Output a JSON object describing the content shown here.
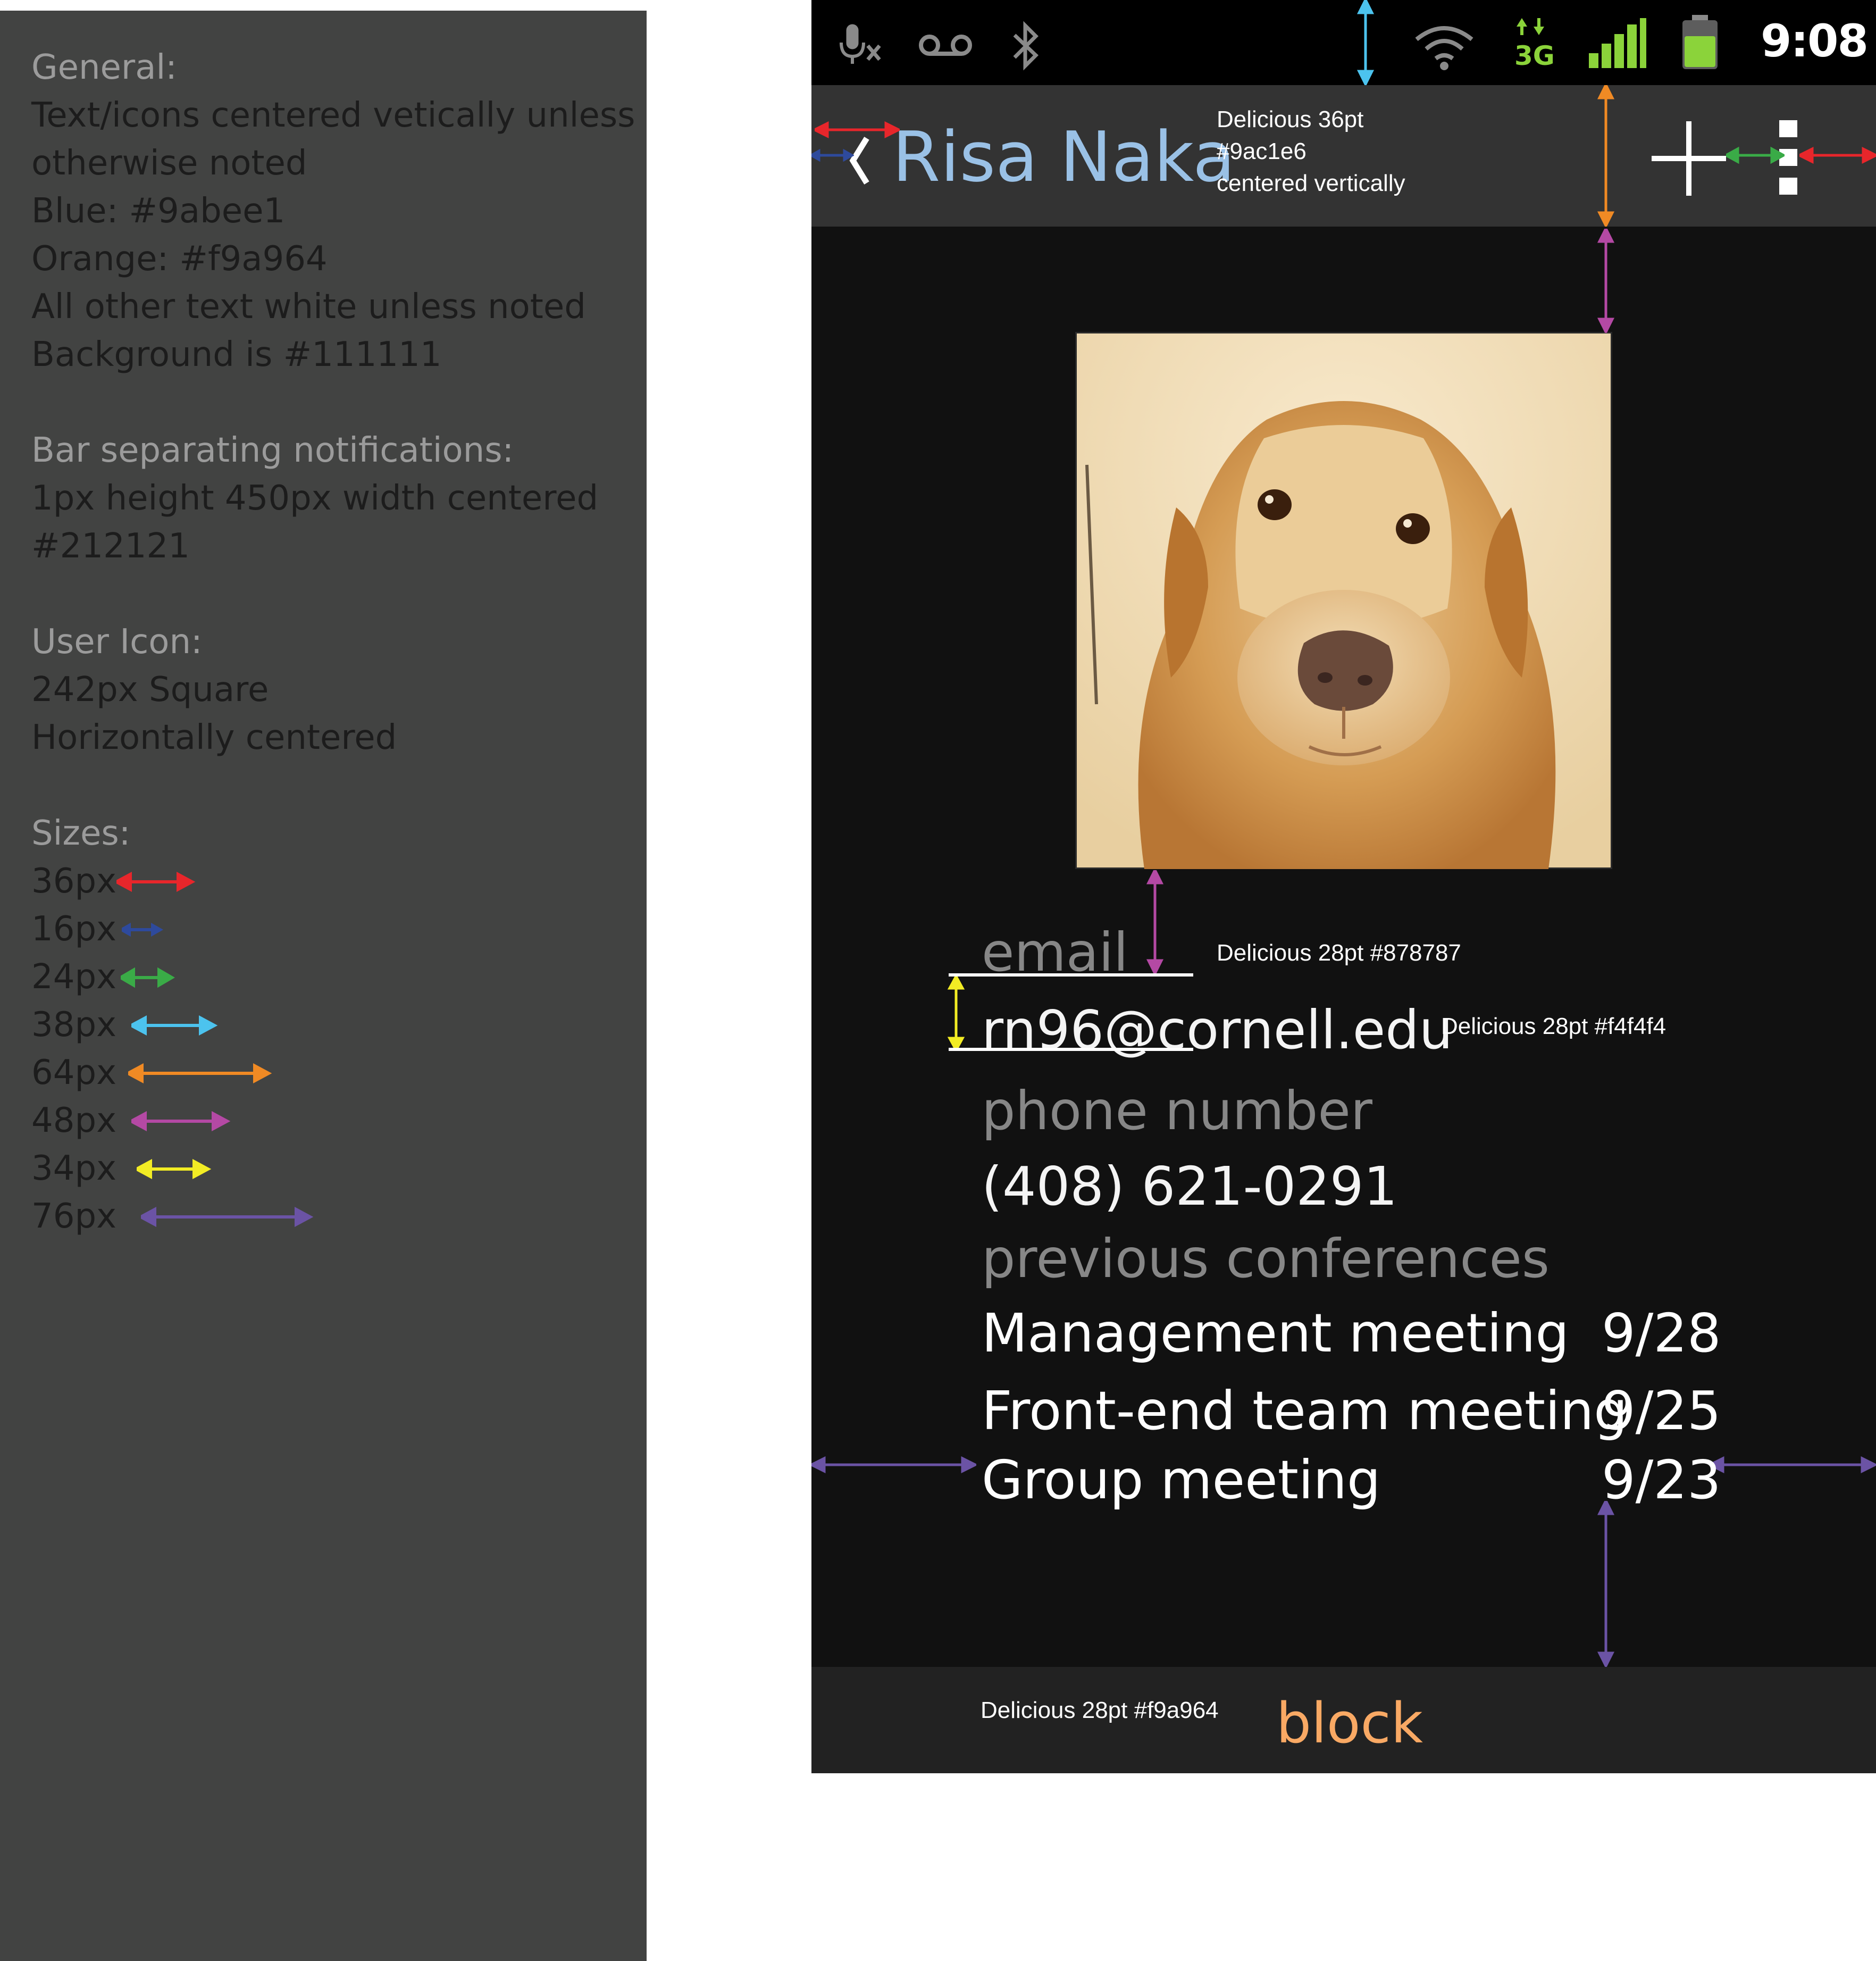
{
  "spec": {
    "general_heading": "General:",
    "general_lines": [
      "Text/icons centered vetically unless",
      "otherwise noted",
      "Blue: #9abee1",
      "Orange: #f9a964",
      "All other text white unless noted",
      "Background is #111111"
    ],
    "bar_heading": "Bar separating notifications:",
    "bar_lines": [
      "1px height 450px width centered",
      "#212121"
    ],
    "icon_heading": "User Icon:",
    "icon_lines": [
      "242px Square",
      "Horizontally centered"
    ],
    "sizes_heading": "Sizes:",
    "sizes": [
      {
        "label": "36px",
        "color": "#e8262b"
      },
      {
        "label": "16px",
        "color": "#2e4a9c"
      },
      {
        "label": "24px",
        "color": "#3aab47"
      },
      {
        "label": "38px",
        "color": "#4cc3ee"
      },
      {
        "label": "64px",
        "color": "#f08a24"
      },
      {
        "label": "48px",
        "color": "#b449a4"
      },
      {
        "label": "34px",
        "color": "#f2ec24"
      },
      {
        "label": "76px",
        "color": "#6b53a5"
      }
    ]
  },
  "status_bar": {
    "icons": [
      "mic-muted-icon",
      "voicemail-icon",
      "bluetooth-icon",
      "wifi-icon",
      "3g-data-icon",
      "signal-icon",
      "battery-icon"
    ],
    "data_type": "3G",
    "time": "9:08"
  },
  "action_bar": {
    "back_icon": "chevron-left-icon",
    "name": "Risa Naka",
    "name_note_lines": [
      "Delicious 36pt",
      "#9ac1e6",
      "centered vertically"
    ],
    "add_icon": "plus-icon",
    "overflow_icon": "overflow-menu-icon"
  },
  "profile": {
    "photo_icon": "dog-photo",
    "email_label": "email",
    "email_label_note": "Delicious 28pt #878787",
    "email_value": "rn96@cornell.edu",
    "email_value_note": "Delicious 28pt #f4f4f4",
    "phone_label": "phone number",
    "phone_value": "(408) 621-0291",
    "conferences_label": "previous conferences",
    "conferences": [
      {
        "name": "Management meeting",
        "date": "9/28"
      },
      {
        "name": "Front-end team meeting",
        "date": "9/25"
      },
      {
        "name": "Group meeting",
        "date": "9/23"
      }
    ]
  },
  "bottom_bar": {
    "note": "Delicious 28pt #f9a964",
    "block_label": "block"
  },
  "colors": {
    "blue": "#9ac1e6",
    "orange": "#f9a964",
    "background": "#111111",
    "label_gray": "#878787",
    "value_white": "#f4f4f4"
  }
}
